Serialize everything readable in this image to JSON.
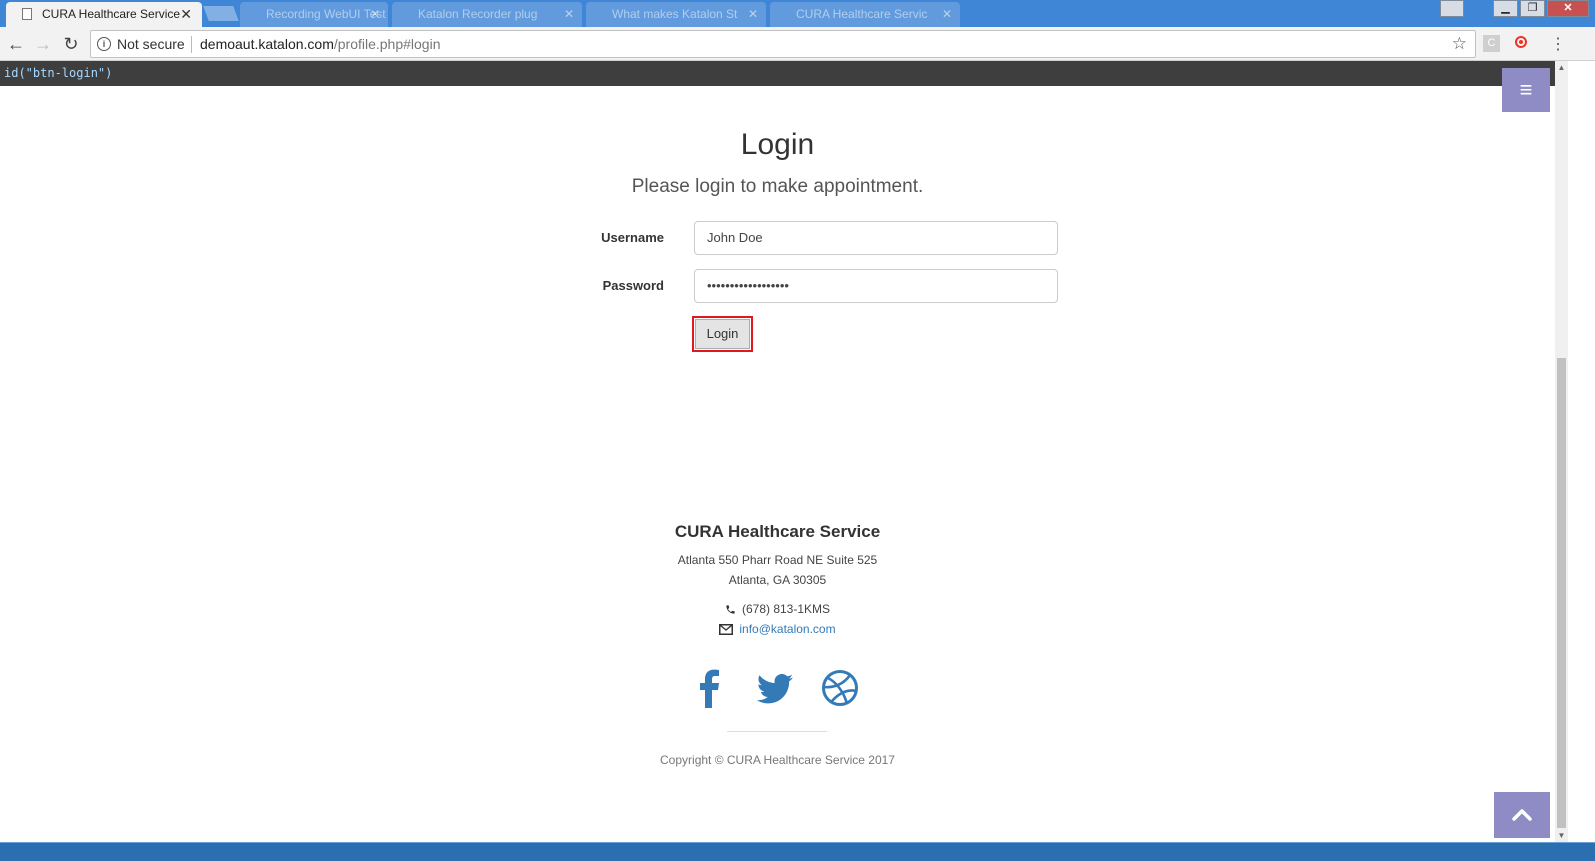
{
  "browser": {
    "active_tab": {
      "title": "CURA Healthcare Service",
      "close": "✕"
    },
    "background_tabs": [
      {
        "title": "Recording WebUI Test",
        "close": "✕"
      },
      {
        "title": "Katalon Recorder plug",
        "close": "✕"
      },
      {
        "title": "What makes Katalon St",
        "close": "✕"
      },
      {
        "title": "CURA Healthcare Servic",
        "close": "✕"
      }
    ],
    "security_label": "Not secure",
    "url_host": "demoaut.katalon.com",
    "url_path": "/profile.php#login",
    "extension_label": "C"
  },
  "locator_bar": {
    "text": "id(\"btn-login\")"
  },
  "page": {
    "title": "Login",
    "subtitle": "Please login to make appointment.",
    "username_label": "Username",
    "username_value": "John Doe",
    "password_label": "Password",
    "password_value": "••••••••••••••••••",
    "login_button": "Login"
  },
  "footer": {
    "company": "CURA Healthcare Service",
    "address_line1": "Atlanta 550 Pharr Road NE Suite 525",
    "address_line2": "Atlanta, GA 30305",
    "phone": "(678) 813-1KMS",
    "email": "info@katalon.com",
    "copyright": "Copyright © CURA Healthcare Service 2017"
  },
  "colors": {
    "accent_purple": "#8f8bc5",
    "link_blue": "#337ab7",
    "highlight_red": "#e0191f",
    "tabbar_blue": "#3f86d6"
  },
  "icons": {
    "menu": "hamburger-icon",
    "back_to_top": "chevron-up-icon",
    "social": [
      "facebook-icon",
      "twitter-icon",
      "dribbble-icon"
    ]
  }
}
